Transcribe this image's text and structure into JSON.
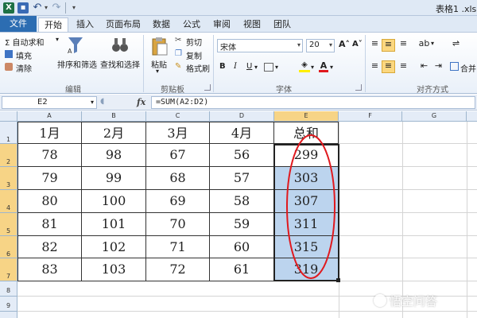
{
  "window": {
    "title": "表格1 .xls"
  },
  "quick_access": {
    "app_icon": "excel-icon",
    "save_icon": "save-icon",
    "undo_icon": "undo-icon",
    "redo_icon": "redo-icon"
  },
  "tabs": [
    {
      "label": "文件"
    },
    {
      "label": "开始"
    },
    {
      "label": "插入"
    },
    {
      "label": "页面布局"
    },
    {
      "label": "数据"
    },
    {
      "label": "公式"
    },
    {
      "label": "审阅"
    },
    {
      "label": "视图"
    },
    {
      "label": "团队"
    }
  ],
  "ribbon": {
    "editing": {
      "autosum": "Σ 自动求和",
      "fill": "填充",
      "clear": "清除",
      "sort_filter": "排序和筛选",
      "find_select": "查找和选择",
      "group_label": "编辑"
    },
    "clipboard": {
      "paste": "粘贴",
      "cut": "剪切",
      "copy": "复制",
      "format_painter": "格式刷",
      "group_label": "剪贴板"
    },
    "font": {
      "font_name": "宋体",
      "font_size": "20",
      "bold": "B",
      "italic": "I",
      "underline": "U",
      "group_label": "字体"
    },
    "alignment": {
      "merge": "合并",
      "group_label": "对齐方式"
    }
  },
  "formula_bar": {
    "name_box": "E2",
    "fx": "fx",
    "formula": "=SUM(A2:D2)"
  },
  "sheet": {
    "columns": [
      "A",
      "B",
      "C",
      "D",
      "E",
      "F",
      "G"
    ],
    "rows": [
      "1",
      "2",
      "3",
      "4",
      "5",
      "6",
      "7",
      "8",
      "9"
    ],
    "header_row": [
      "1月",
      "2月",
      "3月",
      "4月",
      "总和"
    ],
    "data": [
      [
        "78",
        "98",
        "67",
        "56",
        "299"
      ],
      [
        "79",
        "99",
        "68",
        "57",
        "303"
      ],
      [
        "80",
        "100",
        "69",
        "58",
        "307"
      ],
      [
        "81",
        "101",
        "70",
        "59",
        "311"
      ],
      [
        "82",
        "102",
        "71",
        "60",
        "315"
      ],
      [
        "83",
        "103",
        "72",
        "61",
        "319"
      ]
    ],
    "selected_range": "E2:E7",
    "annotation_color": "#e0191e"
  },
  "watermark": {
    "text": "悟空问答"
  }
}
